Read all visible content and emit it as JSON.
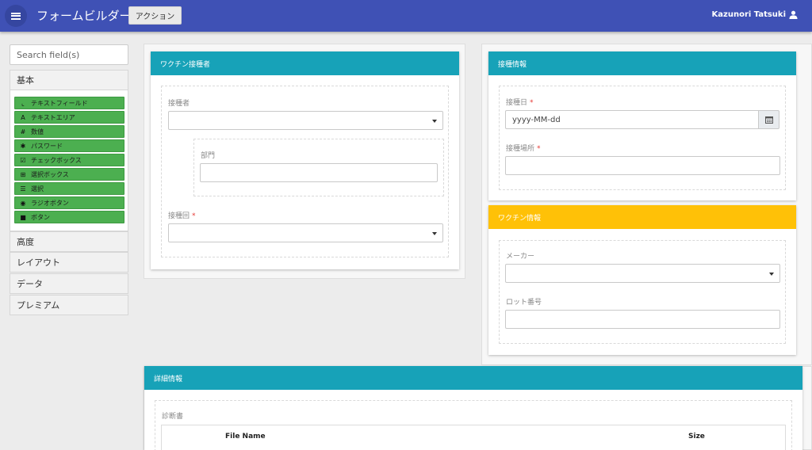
{
  "header": {
    "app_title": "フォームビルダー",
    "action_label": "アクション",
    "user_name": "Kazunori Tatsuki"
  },
  "sidebar": {
    "search_placeholder": "Search field(s)",
    "groups": [
      {
        "label": "基本",
        "items": [
          {
            "icon": "text-field-icon",
            "glyph": "⌞",
            "label": "テキストフィールド"
          },
          {
            "icon": "text-area-icon",
            "glyph": "A",
            "label": "テキストエリア"
          },
          {
            "icon": "hash-icon",
            "glyph": "#",
            "label": "数値"
          },
          {
            "icon": "asterisk-icon",
            "glyph": "✱",
            "label": "パスワード"
          },
          {
            "icon": "checkbox-icon",
            "glyph": "☑",
            "label": "チェックボックス"
          },
          {
            "icon": "plus-square-icon",
            "glyph": "⊞",
            "label": "選択ボックス"
          },
          {
            "icon": "list-icon",
            "glyph": "☰",
            "label": "選択"
          },
          {
            "icon": "radio-icon",
            "glyph": "◉",
            "label": "ラジオボタン"
          },
          {
            "icon": "stop-icon",
            "glyph": "■",
            "label": "ボタン"
          }
        ]
      },
      {
        "label": "高度"
      },
      {
        "label": "レイアウト"
      },
      {
        "label": "データ"
      },
      {
        "label": "プレミアム"
      }
    ]
  },
  "panels": {
    "vaccinee": {
      "title": "ワクチン接種者",
      "person_label": "接種者",
      "department_label": "部門",
      "dose_label": "接種回",
      "required_mark": "*"
    },
    "vaccination": {
      "title": "接種情報",
      "date_label": "接種日",
      "date_placeholder": "yyyy-MM-dd",
      "place_label": "接種場所",
      "required_mark": "*"
    },
    "vaccine": {
      "title": "ワクチン情報",
      "maker_label": "メーカー",
      "lot_label": "ロット番号"
    },
    "details": {
      "title": "詳細情報",
      "certificate_label": "診断書",
      "columns": [
        "File Name",
        "Size"
      ]
    }
  },
  "colors": {
    "header_bg": "#3f51b5",
    "panel_teal": "#17a2b8",
    "panel_amber": "#ffc107",
    "field_green": "#4caf50",
    "required_red": "#e53935"
  }
}
